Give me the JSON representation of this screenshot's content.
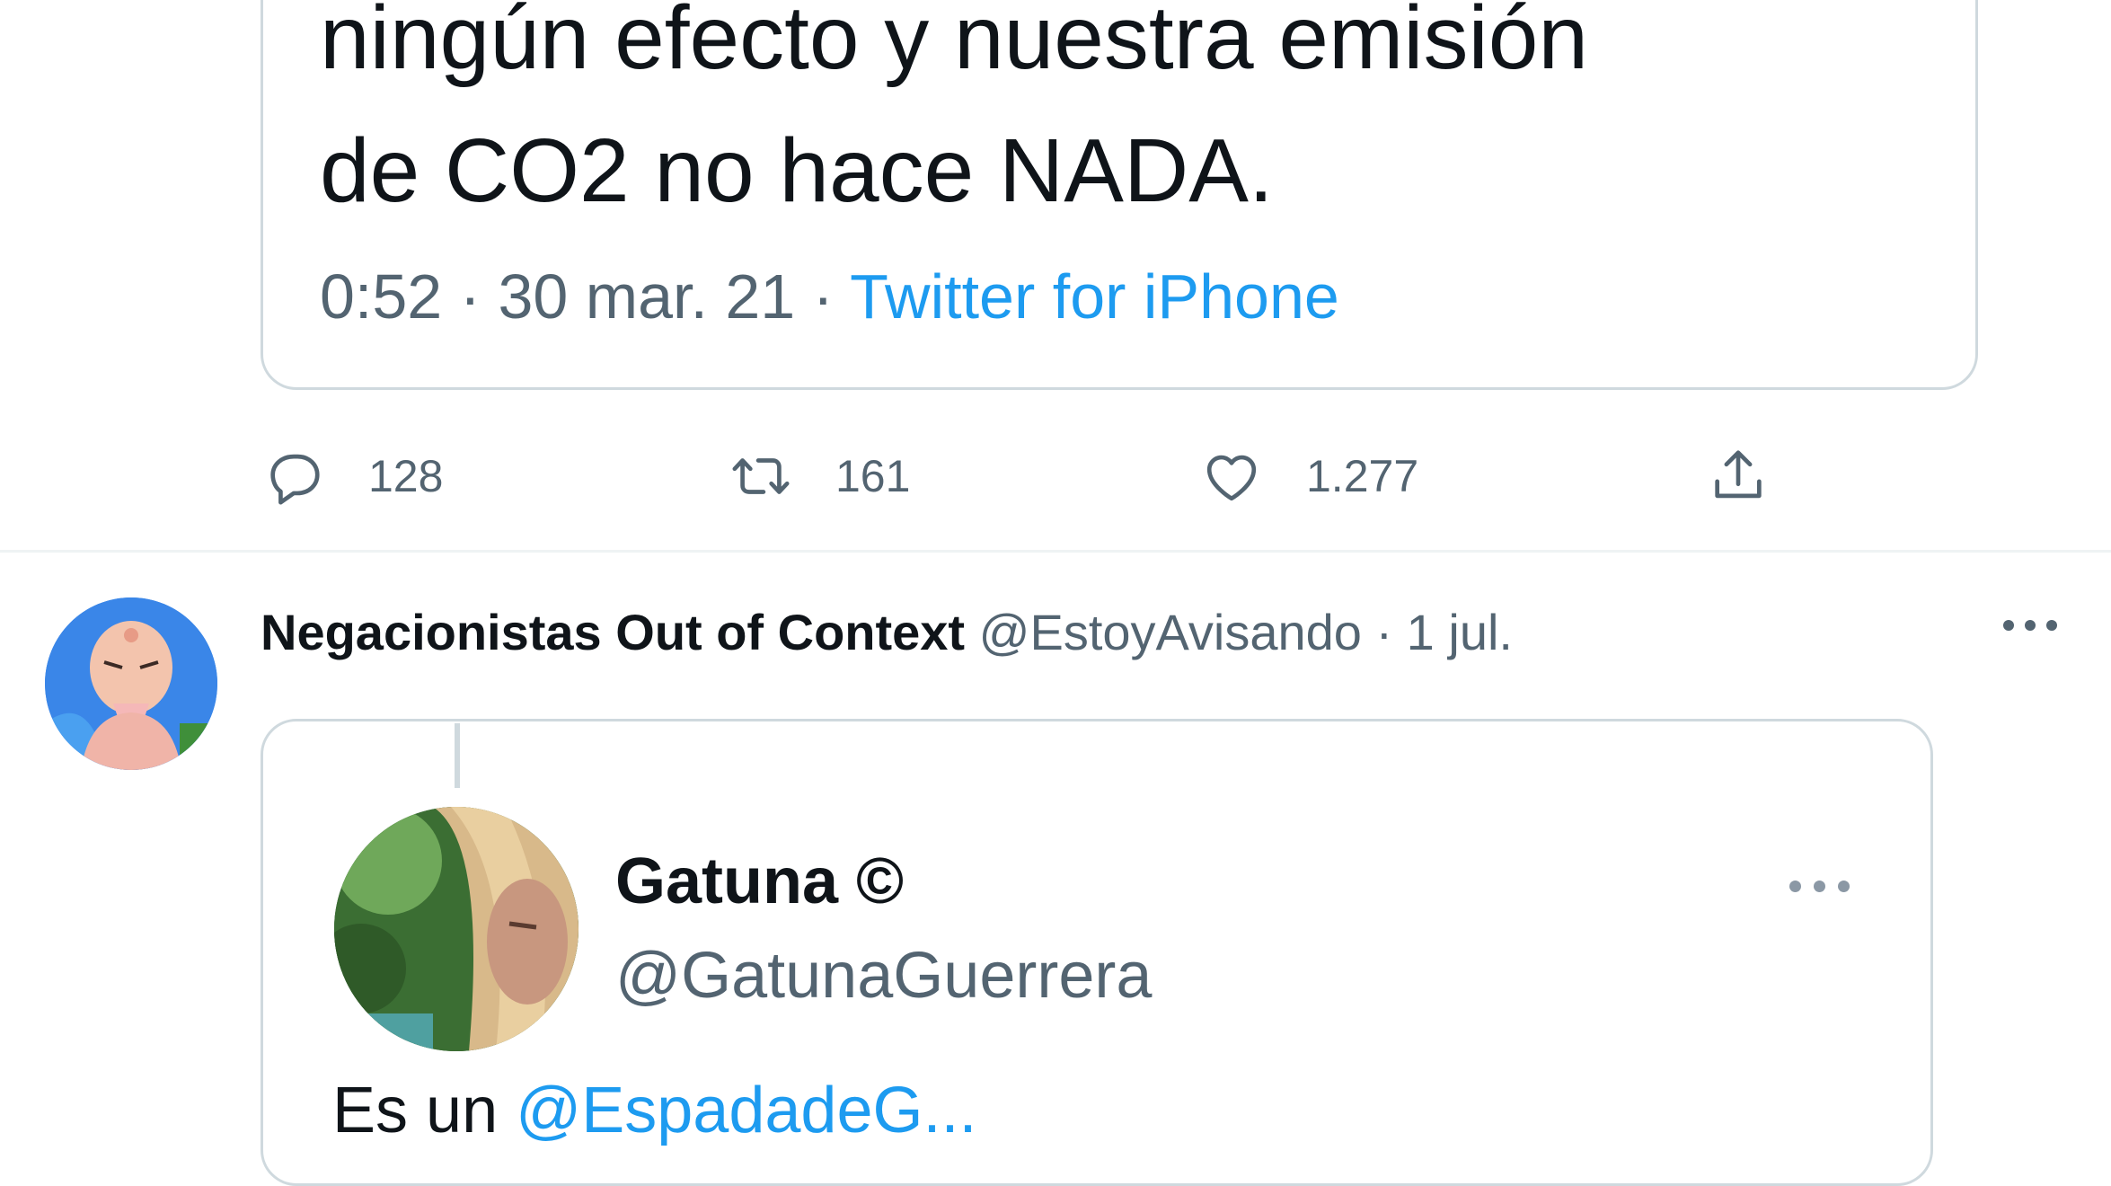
{
  "quoted_tweet": {
    "text_line_1": "ningún efecto y nuestra emisión",
    "text_line_2": "de CO2 no hace NADA.",
    "time": "0:52 · 30 mar. 21 · ",
    "source": "Twitter for iPhone"
  },
  "actions": {
    "reply_icon": "reply-icon",
    "reply_count": "128",
    "retweet_icon": "retweet-icon",
    "retweet_count": "161",
    "like_icon": "heart-icon",
    "like_count": "1.277",
    "share_icon": "share-icon"
  },
  "tweet": {
    "author_name": "Negacionistas Out of Context",
    "author_handle": "@EstoyAvisando · 1 jul.",
    "more_icon": "more-horizontal-icon"
  },
  "embedded_tweet": {
    "author_name": "Gatuna ©",
    "author_handle": "@GatunaGuerrera",
    "more_icon": "more-horizontal-icon",
    "text_start": "Es un ",
    "text_mention": "@EspadadeG..."
  },
  "colors": {
    "link": "#1d9bf0",
    "secondary_text": "#536471",
    "border": "#cfd9de"
  }
}
